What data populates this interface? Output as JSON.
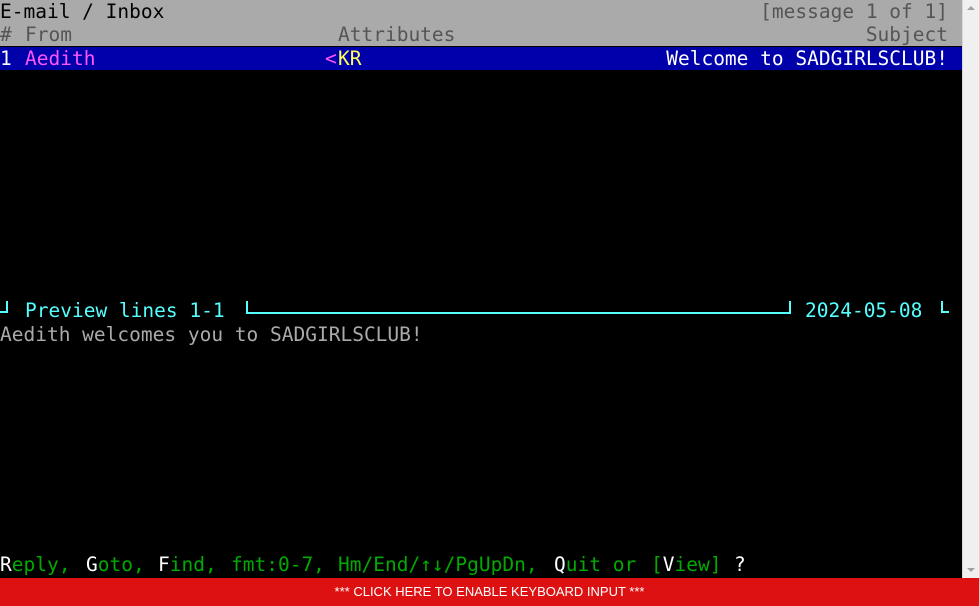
{
  "title": "E-mail / Inbox",
  "message_counter": "[message 1 of 1]",
  "columns": {
    "num": "#",
    "from": "From",
    "attributes": "Attributes",
    "subject": "Subject"
  },
  "messages": [
    {
      "num": "1",
      "from": "Aedith",
      "attr_lt": "<",
      "attr_kr": "KR",
      "subject": "Welcome to SADGIRLSCLUB!"
    }
  ],
  "preview": {
    "label": "Preview lines 1-1",
    "date": "2024-05-08",
    "body": "Aedith welcomes you to SADGIRLSCLUB!"
  },
  "prompt": {
    "reply_key": "R",
    "reply_rest": "eply,",
    "goto_key": "G",
    "goto_rest": "oto,",
    "find_key": "F",
    "find_rest": "ind,",
    "fmt": "fmt:0-7,",
    "nav": "Hm/End/↑↓/PgUpDn,",
    "quit_key": "Q",
    "quit_rest": "uit or",
    "view_open": "[",
    "view_key": "V",
    "view_rest": "iew]",
    "question": "?"
  },
  "keyboard_banner": "*** CLICK HERE TO ENABLE KEYBOARD INPUT ***",
  "colors": {
    "selected_row_bg": "#0000aa",
    "header_bg": "#aaaaaa",
    "banner_bg": "#dd1111",
    "accent_cyan": "#55ffff",
    "from_magenta": "#ff55ff",
    "attr_yellow": "#ffff55",
    "prompt_green": "#00aa00"
  }
}
